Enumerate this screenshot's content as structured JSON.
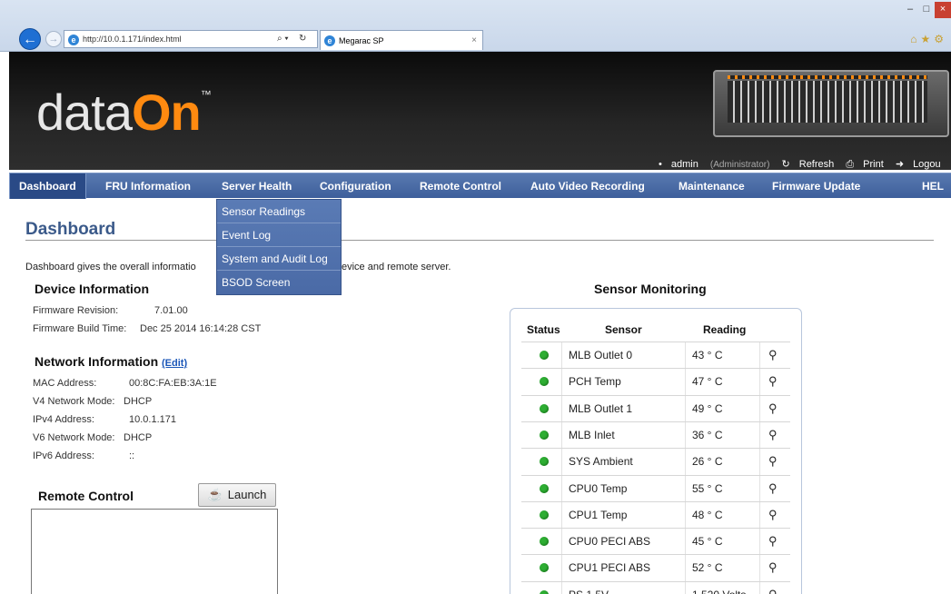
{
  "browser": {
    "url": "http://10.0.1.171/index.html",
    "tab_title": "Megarac SP",
    "tab_close": "×",
    "minimize": "–",
    "maximize": "□",
    "close": "×"
  },
  "header": {
    "logo_prefix": "data",
    "logo_accent": "On",
    "logo_tm": "™",
    "user": "admin",
    "role": "(Administrator)",
    "refresh": "Refresh",
    "print": "Print",
    "logout": "Logou"
  },
  "nav": {
    "items": [
      "Dashboard",
      "FRU Information",
      "Server Health",
      "Configuration",
      "Remote Control",
      "Auto Video Recording",
      "Maintenance",
      "Firmware Update",
      "HEL"
    ],
    "active": "Dashboard"
  },
  "dropdown": {
    "items": [
      "Sensor Readings",
      "Event Log",
      "System and Audit Log",
      "BSOD Screen"
    ]
  },
  "page": {
    "title": "Dashboard",
    "description_left": "Dashboard gives the overall informatio",
    "description_right": "evice and remote server."
  },
  "device_info": {
    "title": "Device Information",
    "firmware_revision_label": "Firmware Revision:",
    "firmware_revision": "7.01.00",
    "firmware_build_label": "Firmware Build Time:",
    "firmware_build": "Dec 25 2014 16:14:28 CST"
  },
  "network_info": {
    "title": "Network Information",
    "edit": "(Edit)",
    "mac_label": "MAC Address:",
    "mac": "00:8C:FA:EB:3A:1E",
    "v4mode_label": "V4 Network Mode:",
    "v4mode": "DHCP",
    "ipv4_label": "IPv4 Address:",
    "ipv4": "10.0.1.171",
    "v6mode_label": "V6 Network Mode:",
    "v6mode": "DHCP",
    "ipv6_label": "IPv6 Address:",
    "ipv6": "::"
  },
  "remote_control": {
    "title": "Remote Control",
    "launch": "Launch"
  },
  "sensor_monitoring": {
    "title": "Sensor Monitoring",
    "headers": [
      "Status",
      "Sensor",
      "Reading"
    ],
    "status_color": "#2eae33",
    "rows": [
      {
        "sensor": "MLB Outlet 0",
        "reading": "43 ° C"
      },
      {
        "sensor": "PCH Temp",
        "reading": "47 ° C"
      },
      {
        "sensor": "MLB Outlet 1",
        "reading": "49 ° C"
      },
      {
        "sensor": "MLB Inlet",
        "reading": "36 ° C"
      },
      {
        "sensor": "SYS Ambient",
        "reading": "26 ° C"
      },
      {
        "sensor": "CPU0 Temp",
        "reading": "55 ° C"
      },
      {
        "sensor": "CPU1 Temp",
        "reading": "48 ° C"
      },
      {
        "sensor": "CPU0 PECI ABS",
        "reading": "45 ° C"
      },
      {
        "sensor": "CPU1 PECI ABS",
        "reading": "52 ° C"
      },
      {
        "sensor": "PS 1.5V",
        "reading": "1.520 Volts"
      }
    ]
  }
}
